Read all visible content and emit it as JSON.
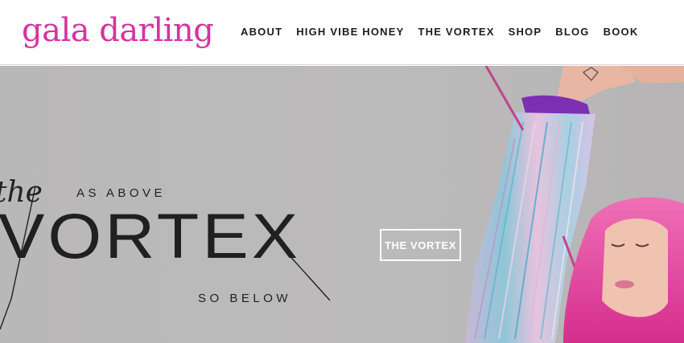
{
  "brand": {
    "logo_text": "gala darling",
    "accent_color": "#d6339f"
  },
  "nav": {
    "items": [
      {
        "label": "ABOUT"
      },
      {
        "label": "HIGH VIBE HONEY"
      },
      {
        "label": "THE VORTEX"
      },
      {
        "label": "SHOP"
      },
      {
        "label": "BLOG"
      },
      {
        "label": "BOOK"
      }
    ]
  },
  "hero": {
    "the_text": "the",
    "above_text": "AS ABOVE",
    "vortex_text": "VORTEX",
    "below_text": "SO BELOW",
    "cta_label": "THE VORTEX",
    "background_color": "#bab9b9",
    "hair_color": "#e83e9c",
    "line_color": "#c2438f"
  }
}
